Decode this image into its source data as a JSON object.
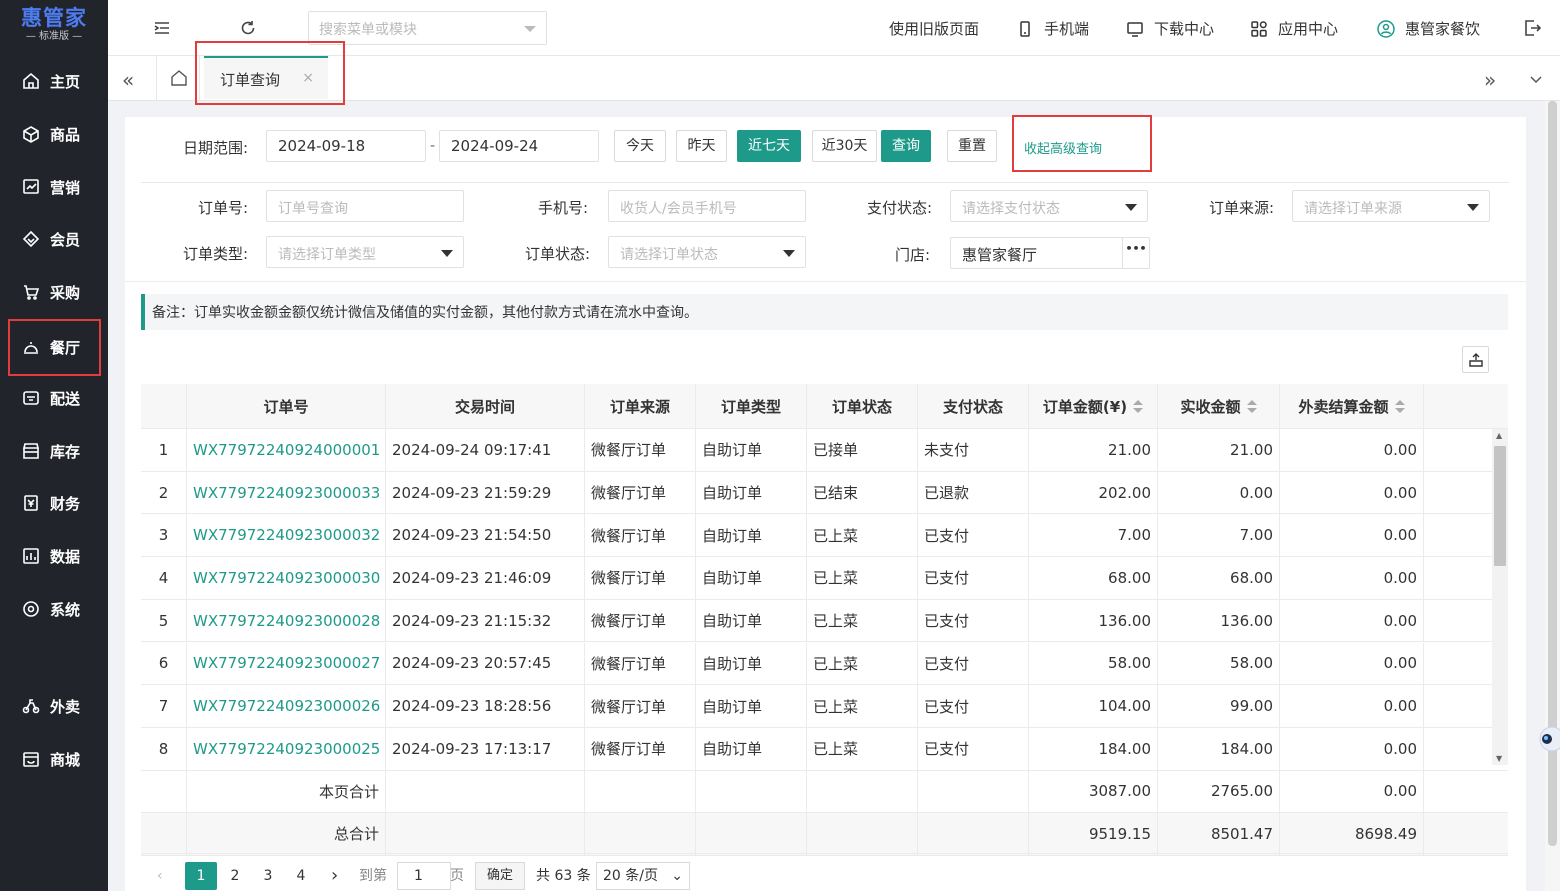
{
  "sidebar": {
    "brand": "惠管家",
    "edition": "标准版",
    "items": [
      {
        "label": "主页",
        "icon": "home-icon"
      },
      {
        "label": "商品",
        "icon": "box-icon"
      },
      {
        "label": "营销",
        "icon": "chart-icon"
      },
      {
        "label": "会员",
        "icon": "diamond-icon"
      },
      {
        "label": "采购",
        "icon": "cart-icon"
      },
      {
        "label": "餐厅",
        "icon": "cloche-icon"
      },
      {
        "label": "配送",
        "icon": "delivery-icon"
      },
      {
        "label": "库存",
        "icon": "store-icon"
      },
      {
        "label": "财务",
        "icon": "finance-icon"
      },
      {
        "label": "数据",
        "icon": "data-icon"
      },
      {
        "label": "系统",
        "icon": "settings-icon"
      },
      {
        "label": "外卖",
        "icon": "bike-icon"
      },
      {
        "label": "商城",
        "icon": "shop-icon"
      }
    ],
    "active_index": 5
  },
  "topbar": {
    "search_placeholder": "搜索菜单或模块",
    "old_page": "使用旧版页面",
    "mobile": "手机端",
    "download": "下载中心",
    "apps": "应用中心",
    "user": "惠管家餐饮"
  },
  "tabs": {
    "active_label": "订单查询",
    "close_glyph": "×"
  },
  "filters": {
    "date_label": "日期范围:",
    "date_from": "2024-09-18",
    "date_sep": "-",
    "date_to": "2024-09-24",
    "btn_today": "今天",
    "btn_yesterday": "昨天",
    "btn_7days": "近七天",
    "btn_30days": "近30天",
    "btn_query": "查询",
    "btn_reset": "重置",
    "advanced_toggle": "收起高级查询",
    "order_no_label": "订单号:",
    "order_no_placeholder": "订单号查询",
    "phone_label": "手机号:",
    "phone_placeholder": "收货人/会员手机号",
    "pay_status_label": "支付状态:",
    "pay_status_placeholder": "请选择支付状态",
    "source_label": "订单来源:",
    "source_placeholder": "请选择订单来源",
    "type_label": "订单类型:",
    "type_placeholder": "请选择订单类型",
    "order_status_label": "订单状态:",
    "order_status_placeholder": "请选择订单状态",
    "store_label": "门店:",
    "store_value": "惠管家餐厅",
    "store_more": "•••"
  },
  "note": "备注：订单实收金额金额仅统计微信及储值的实付金额，其他付款方式请在流水中查询。",
  "table": {
    "headers": [
      "订单号",
      "交易时间",
      "订单来源",
      "订单类型",
      "订单状态",
      "支付状态",
      "订单金额(¥)",
      "实收金额",
      "外卖结算金额"
    ],
    "rows": [
      {
        "idx": "1",
        "order": "WX77972240924000001",
        "time": "2024-09-24 09:17:41",
        "source": "微餐厅订单",
        "type": "自助订单",
        "status": "已接单",
        "pay": "未支付",
        "amount": "21.00",
        "received": "21.00",
        "settle": "0.00"
      },
      {
        "idx": "2",
        "order": "WX77972240923000033",
        "time": "2024-09-23 21:59:29",
        "source": "微餐厅订单",
        "type": "自助订单",
        "status": "已结束",
        "pay": "已退款",
        "amount": "202.00",
        "received": "0.00",
        "settle": "0.00"
      },
      {
        "idx": "3",
        "order": "WX77972240923000032",
        "time": "2024-09-23 21:54:50",
        "source": "微餐厅订单",
        "type": "自助订单",
        "status": "已上菜",
        "pay": "已支付",
        "amount": "7.00",
        "received": "7.00",
        "settle": "0.00"
      },
      {
        "idx": "4",
        "order": "WX77972240923000030",
        "time": "2024-09-23 21:46:09",
        "source": "微餐厅订单",
        "type": "自助订单",
        "status": "已上菜",
        "pay": "已支付",
        "amount": "68.00",
        "received": "68.00",
        "settle": "0.00"
      },
      {
        "idx": "5",
        "order": "WX77972240923000028",
        "time": "2024-09-23 21:15:32",
        "source": "微餐厅订单",
        "type": "自助订单",
        "status": "已上菜",
        "pay": "已支付",
        "amount": "136.00",
        "received": "136.00",
        "settle": "0.00"
      },
      {
        "idx": "6",
        "order": "WX77972240923000027",
        "time": "2024-09-23 20:57:45",
        "source": "微餐厅订单",
        "type": "自助订单",
        "status": "已上菜",
        "pay": "已支付",
        "amount": "58.00",
        "received": "58.00",
        "settle": "0.00"
      },
      {
        "idx": "7",
        "order": "WX77972240923000026",
        "time": "2024-09-23 18:28:56",
        "source": "微餐厅订单",
        "type": "自助订单",
        "status": "已上菜",
        "pay": "已支付",
        "amount": "104.00",
        "received": "99.00",
        "settle": "0.00"
      },
      {
        "idx": "8",
        "order": "WX77972240923000025",
        "time": "2024-09-23 17:13:17",
        "source": "微餐厅订单",
        "type": "自助订单",
        "status": "已上菜",
        "pay": "已支付",
        "amount": "184.00",
        "received": "184.00",
        "settle": "0.00"
      }
    ],
    "page_sum": {
      "label": "本页合计",
      "amount": "3087.00",
      "received": "2765.00",
      "settle": "0.00"
    },
    "grand_total": {
      "label": "总合计",
      "amount": "9519.15",
      "received": "8501.47",
      "settle": "8698.49"
    }
  },
  "pagination": {
    "pages": [
      "1",
      "2",
      "3",
      "4"
    ],
    "current": "1",
    "goto_label": "到第",
    "goto_value": "1",
    "page_unit": "页",
    "confirm": "确定",
    "total": "共 63 条",
    "page_size": "20 条/页"
  },
  "colors": {
    "accent": "#1d9a8a",
    "sidebar_bg": "#21242b",
    "highlight": "#e23c3c",
    "brand": "#4c7cf0"
  }
}
